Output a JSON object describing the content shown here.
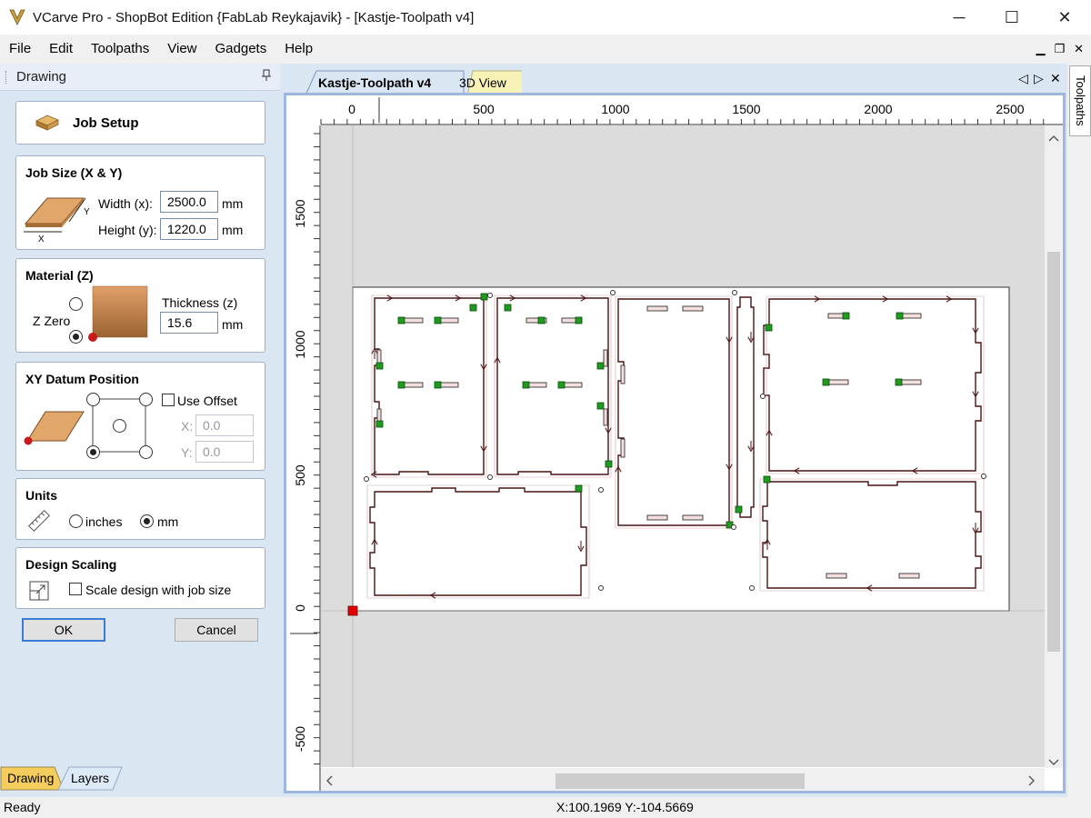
{
  "window": {
    "title": "VCarve Pro - ShopBot Edition {FabLab Reykajavik} - [Kastje-Toolpath v4]",
    "minimize": "─",
    "maximize": "☐",
    "close": "✕"
  },
  "menu": [
    "File",
    "Edit",
    "Toolpaths",
    "View",
    "Gadgets",
    "Help"
  ],
  "mdi": {
    "minimize": "▁",
    "restore": "❐",
    "close": "✕"
  },
  "panel": {
    "title": "Drawing",
    "pin": "▭",
    "job_setup": "Job Setup",
    "job_size": {
      "title": "Job Size (X & Y)",
      "width_label": "Width (x):",
      "width_value": "2500.0",
      "height_label": "Height (y):",
      "height_value": "1220.0",
      "unit": "mm",
      "x_axis": "X",
      "y_axis": "Y"
    },
    "material": {
      "title": "Material (Z)",
      "z_zero_label": "Z Zero",
      "thickness_label": "Thickness (z)",
      "thickness_value": "15.6",
      "unit": "mm"
    },
    "datum": {
      "title": "XY Datum Position",
      "use_offset": "Use Offset",
      "x_label": "X:",
      "x_value": "0.0",
      "y_label": "Y:",
      "y_value": "0.0"
    },
    "units": {
      "title": "Units",
      "inches": "inches",
      "mm": "mm",
      "selected": "mm"
    },
    "scaling": {
      "title": "Design Scaling",
      "checkbox_label": "Scale design with job size"
    },
    "ok": "OK",
    "cancel": "Cancel",
    "bottom_tabs": [
      "Drawing",
      "Layers"
    ]
  },
  "doc_tabs": [
    "Kastje-Toolpath v4",
    "3D View"
  ],
  "tab_nav": {
    "prev": "◁",
    "next": "▷",
    "close": "✕"
  },
  "ruler": {
    "x_labels": [
      "0",
      "500",
      "1000",
      "1500",
      "2000",
      "2500"
    ],
    "y_labels": [
      "1500",
      "1000",
      "500",
      "0",
      "-500"
    ]
  },
  "side_tab": "Toolpaths",
  "status": {
    "left": "Ready",
    "coords": "X:100.1969 Y:-104.5669"
  },
  "colors": {
    "panel_bg": "#dbe6f3",
    "frame_border": "#9db7e0",
    "active_tab": "#dbe6f3",
    "view_tab": "#f7f3b7",
    "vector": "#4a1515",
    "start_node": "#1f9b1f",
    "origin_marker": "#e00000"
  }
}
